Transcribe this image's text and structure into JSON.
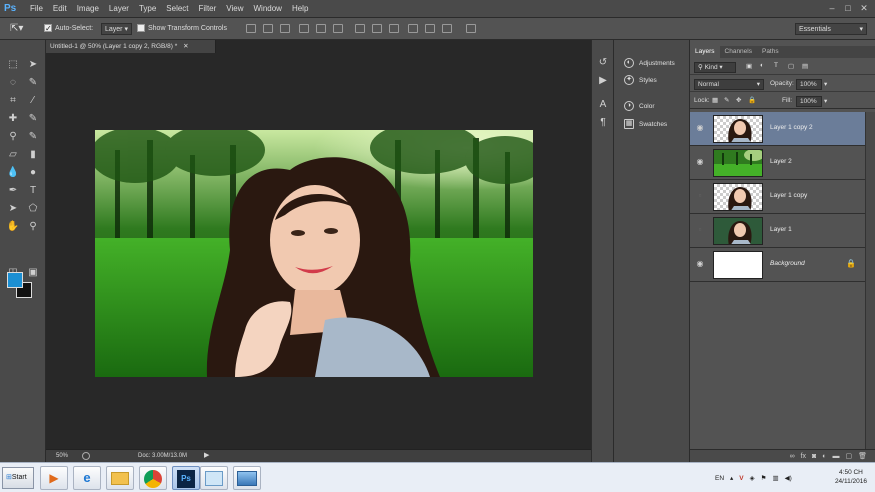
{
  "app": {
    "logo": "Ps",
    "menus": [
      "File",
      "Edit",
      "Image",
      "Layer",
      "Type",
      "Select",
      "Filter",
      "View",
      "Window",
      "Help"
    ]
  },
  "options_bar": {
    "auto_select_label": "Auto-Select:",
    "auto_select_checked": true,
    "auto_select_target": "Layer",
    "show_transform_label": "Show Transform Controls",
    "show_transform_checked": false,
    "workspace": "Essentials"
  },
  "document": {
    "tab_title": "Untitled-1 @ 50% (Layer 1 copy 2, RGB/8) *",
    "zoom": "50%",
    "doc_info": "Doc: 3.00M/13.0M"
  },
  "colors": {
    "foreground": "#1b8fd3",
    "background": "#111111",
    "selected_layer": "#6b7d99"
  },
  "collapsed_panels": [
    {
      "icon": "adjustments-icon",
      "label": "Adjustments"
    },
    {
      "icon": "styles-icon",
      "label": "Styles"
    },
    {
      "icon": "color-icon",
      "label": "Color"
    },
    {
      "icon": "swatches-icon",
      "label": "Swatches"
    }
  ],
  "layers_panel": {
    "tabs": [
      "Layers",
      "Channels",
      "Paths"
    ],
    "filter_kind": "Kind",
    "blend_mode": "Normal",
    "opacity_label": "Opacity:",
    "opacity": "100%",
    "lock_label": "Lock:",
    "fill_label": "Fill:",
    "fill": "100%",
    "layers": [
      {
        "name": "Layer 1 copy 2",
        "visible": true,
        "selected": true,
        "thumb": "portrait-transparent"
      },
      {
        "name": "Layer 2",
        "visible": true,
        "selected": false,
        "thumb": "forest"
      },
      {
        "name": "Layer 1 copy",
        "visible": false,
        "selected": false,
        "thumb": "portrait-transparent"
      },
      {
        "name": "Layer 1",
        "visible": false,
        "selected": false,
        "thumb": "portrait-photo"
      },
      {
        "name": "Background",
        "visible": true,
        "selected": false,
        "thumb": "white",
        "locked": true
      }
    ]
  },
  "taskbar": {
    "start_label": "Start",
    "language": "EN",
    "time": "4:50 CH",
    "date": "24/11/2016"
  }
}
